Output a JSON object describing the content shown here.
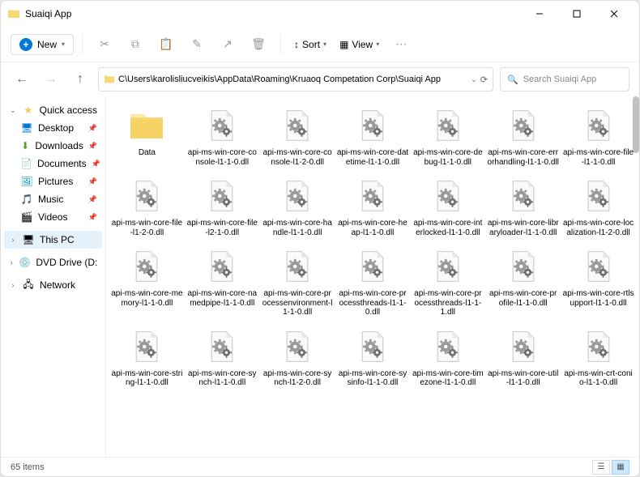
{
  "title": "Suaiqi App",
  "toolbar": {
    "new_label": "New",
    "sort_label": "Sort",
    "view_label": "View"
  },
  "address_path": "C\\Users\\karolisliucveikis\\AppData\\Roaming\\Kruaoq Competation Corp\\Suaiqi App",
  "search_placeholder": "Search Suaiqi App",
  "sidebar": {
    "quick_access": "Quick access",
    "items": [
      {
        "label": "Desktop"
      },
      {
        "label": "Downloads"
      },
      {
        "label": "Documents"
      },
      {
        "label": "Pictures"
      },
      {
        "label": "Music"
      },
      {
        "label": "Videos"
      }
    ],
    "this_pc": "This PC",
    "dvd": "DVD Drive (D:) CCCC",
    "network": "Network"
  },
  "files": [
    {
      "name": "Data",
      "type": "folder"
    },
    {
      "name": "api-ms-win-core-console-l1-1-0.dll",
      "type": "dll"
    },
    {
      "name": "api-ms-win-core-console-l1-2-0.dll",
      "type": "dll"
    },
    {
      "name": "api-ms-win-core-datetime-l1-1-0.dll",
      "type": "dll"
    },
    {
      "name": "api-ms-win-core-debug-l1-1-0.dll",
      "type": "dll"
    },
    {
      "name": "api-ms-win-core-errorhandling-l1-1-0.dll",
      "type": "dll"
    },
    {
      "name": "api-ms-win-core-file-l1-1-0.dll",
      "type": "dll"
    },
    {
      "name": "api-ms-win-core-file-l1-2-0.dll",
      "type": "dll"
    },
    {
      "name": "api-ms-win-core-file-l2-1-0.dll",
      "type": "dll"
    },
    {
      "name": "api-ms-win-core-handle-l1-1-0.dll",
      "type": "dll"
    },
    {
      "name": "api-ms-win-core-heap-l1-1-0.dll",
      "type": "dll"
    },
    {
      "name": "api-ms-win-core-interlocked-l1-1-0.dll",
      "type": "dll"
    },
    {
      "name": "api-ms-win-core-libraryloader-l1-1-0.dll",
      "type": "dll"
    },
    {
      "name": "api-ms-win-core-localization-l1-2-0.dll",
      "type": "dll"
    },
    {
      "name": "api-ms-win-core-memory-l1-1-0.dll",
      "type": "dll"
    },
    {
      "name": "api-ms-win-core-namedpipe-l1-1-0.dll",
      "type": "dll"
    },
    {
      "name": "api-ms-win-core-processenvironment-l1-1-0.dll",
      "type": "dll"
    },
    {
      "name": "api-ms-win-core-processthreads-l1-1-0.dll",
      "type": "dll"
    },
    {
      "name": "api-ms-win-core-processthreads-l1-1-1.dll",
      "type": "dll"
    },
    {
      "name": "api-ms-win-core-profile-l1-1-0.dll",
      "type": "dll"
    },
    {
      "name": "api-ms-win-core-rtlsupport-l1-1-0.dll",
      "type": "dll"
    },
    {
      "name": "api-ms-win-core-string-l1-1-0.dll",
      "type": "dll"
    },
    {
      "name": "api-ms-win-core-synch-l1-1-0.dll",
      "type": "dll"
    },
    {
      "name": "api-ms-win-core-synch-l1-2-0.dll",
      "type": "dll"
    },
    {
      "name": "api-ms-win-core-sysinfo-l1-1-0.dll",
      "type": "dll"
    },
    {
      "name": "api-ms-win-core-timezone-l1-1-0.dll",
      "type": "dll"
    },
    {
      "name": "api-ms-win-core-util-l1-1-0.dll",
      "type": "dll"
    },
    {
      "name": "api-ms-win-crt-conio-l1-1-0.dll",
      "type": "dll"
    }
  ],
  "status_text": "65 items",
  "icons": {
    "desktop_color": "#0078d4",
    "downloads_color": "#5aa02c",
    "documents_color": "#8a8a8a",
    "pictures_color": "#0099bc",
    "music_color": "#d13438",
    "videos_color": "#8764b8"
  }
}
